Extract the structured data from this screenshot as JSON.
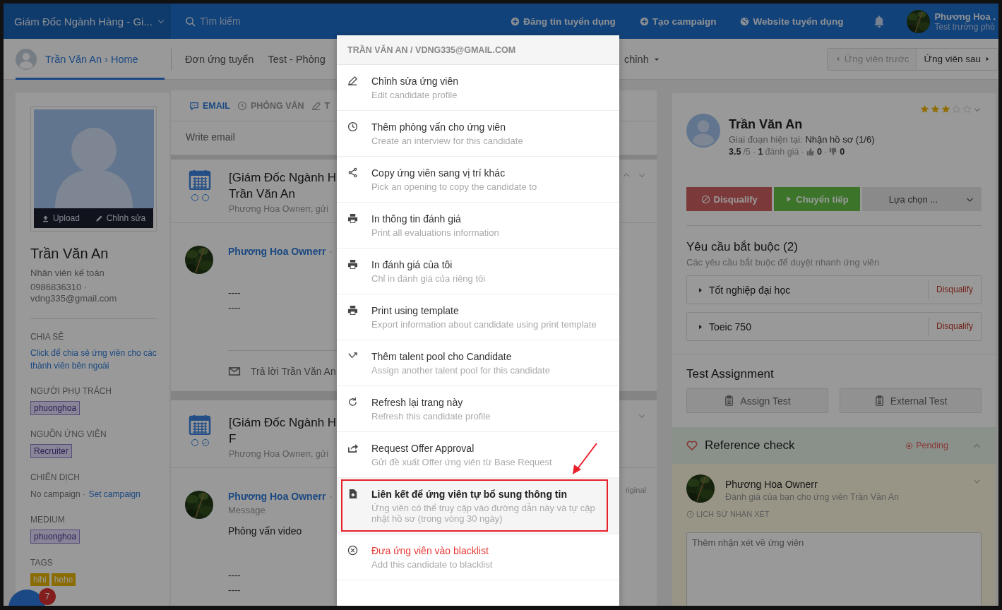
{
  "topbar": {
    "job_selector": "Giám Đốc Ngành Hàng - Gi...",
    "search": {
      "placeholder": "Tìm kiếm"
    },
    "actions": [
      "Đăng tin tuyển dụng",
      "Tạo campaign",
      "Website tuyển dụng"
    ],
    "user": {
      "name": "Phương Hoa .",
      "role": "Test trưởng phò"
    }
  },
  "subnav": {
    "tabs": [
      {
        "label": "Trần Văn An › Home",
        "kind": "home",
        "selected": true
      },
      {
        "label": "Đơn ứng tuyển",
        "kind": "plain",
        "selected": false
      },
      {
        "label": "Test - Phỏng",
        "kind": "plain",
        "selected": false
      },
      {
        "label": "chỉnh",
        "kind": "dropdown",
        "selected": false
      }
    ],
    "prev": {
      "label": "Ứng viên trước",
      "disabled": true
    },
    "next": {
      "label": "Ứng viên sau",
      "disabled": false
    }
  },
  "profile": {
    "photo_actions": [
      "Upload",
      "Chỉnh sửa"
    ],
    "name": "Trần Văn An",
    "title": "Nhân viên kế toán",
    "contact": "0986836310 · vdng335@gmail.com",
    "sections": [
      {
        "heading": "CHIA SẺ",
        "kind": "link",
        "text": "Click để chia sẻ ứng viên cho các thành viên bên ngoài"
      },
      {
        "heading": "NGƯỜI PHỤ TRÁCH",
        "kind": "tags",
        "tags": [
          "phuonghoa"
        ]
      },
      {
        "heading": "NGUỒN ỨNG VIÊN",
        "kind": "tags",
        "tags": [
          "Recruiter"
        ]
      },
      {
        "heading": "CHIẾN DỊCH",
        "kind": "campaign",
        "text": "No campaign ·",
        "link": "Set campaign"
      },
      {
        "heading": "MEDIUM",
        "kind": "tags",
        "tags": [
          "phuonghoa"
        ]
      },
      {
        "heading": "TAGS",
        "kind": "labels",
        "tags": [
          "hihi",
          "hehe"
        ]
      }
    ],
    "chat": {
      "badge": "7"
    }
  },
  "activity": {
    "tabs": [
      {
        "label": "EMAIL",
        "selected": true
      },
      {
        "label": "PHỎNG VẤN",
        "selected": false
      },
      {
        "label": "T",
        "selected": false
      }
    ],
    "compose": {
      "placeholder": "Write email"
    },
    "items": [
      {
        "title_lines": [
          "[Giám Đốc Ngành H",
          "Trần Văn An"
        ],
        "meta": "Phương Hoa Ownerr, gửi",
        "steps": [
          {
            "done": false
          },
          {
            "done": false
          }
        ],
        "expanded": true,
        "comment": {
          "author": "Phương Hoa Ownerr",
          "after": "·",
          "signature": [
            "----",
            "----"
          ],
          "reply": "Trả lời Trần Văn An"
        }
      },
      {
        "title_lines": [
          "[Giám Đốc Ngành H",
          "F"
        ],
        "meta": "Phương Hoa Ownerr, gửi",
        "steps": [
          {
            "done": false
          },
          {
            "done": true
          }
        ],
        "expanded": false,
        "comment": {
          "author": "Phương Hoa Ownerr",
          "after": "·",
          "label": "Message",
          "body": "Phỏng vấn video",
          "signature": [
            "----",
            "----"
          ],
          "side_text": "riginal"
        }
      }
    ]
  },
  "candidate": {
    "stars": 3,
    "name": "Trần Văn An",
    "stage_label": "Giai đoạn hiện tại:",
    "stage": "Nhận hồ sơ (1/6)",
    "rating": {
      "score": "3.5",
      "out_of": "/5 ·",
      "count": "1",
      "count_label": "đánh giá ·",
      "likes": "0",
      "sep": "·",
      "dislikes": "0"
    },
    "actions": [
      {
        "label": "Disqualify",
        "kind": "reject"
      },
      {
        "label": "Chuyển tiếp",
        "kind": "advance"
      },
      {
        "label": "Lựa chọn ...",
        "kind": "select"
      }
    ]
  },
  "requirements": {
    "title": "Yêu cầu bắt buộc (2)",
    "subtitle": "Các yêu cầu bắt buộc để duyệt nhanh ứng viên",
    "items": [
      {
        "label": "Tốt nghiệp đại học",
        "action": "Disqualify"
      },
      {
        "label": "Toeic 750",
        "action": "Disqualify"
      }
    ]
  },
  "tests": {
    "title": "Test Assignment",
    "buttons": [
      "Assign Test",
      "External Test"
    ]
  },
  "reference": {
    "title": "Reference check",
    "status": "Pending",
    "expanded": true,
    "reviewer": {
      "name": "Phương Hoa Ownerr",
      "subtitle": "Đánh giá của bạn cho ứng viên Trần Văn An"
    },
    "history": "LỊCH SỬ NHẬN XÉT",
    "comment": {
      "placeholder": "Thêm nhận xét về ứng viên"
    }
  },
  "menu": {
    "backdrop": true,
    "header": "TRẦN VĂN AN / VDNG335@GMAIL.COM",
    "items": [
      {
        "title": "Chỉnh sửa ứng viên",
        "subtitle": "Edit candidate profile",
        "selected": false,
        "danger": false,
        "annotated": false
      },
      {
        "title": "Thêm phỏng vấn cho ứng viên",
        "subtitle": "Create an interview for this candidate",
        "selected": false,
        "danger": false,
        "annotated": false
      },
      {
        "title": "Copy ứng viên sang vị trí khác",
        "subtitle": "Pick an opening to copy the candidate to",
        "selected": false,
        "danger": false,
        "annotated": false
      },
      {
        "title": "In thông tin đánh giá",
        "subtitle": "Print all evaluations information",
        "selected": false,
        "danger": false,
        "annotated": false
      },
      {
        "title": "In đánh giá của tôi",
        "subtitle": "Chỉ in đánh giá của riêng tôi",
        "selected": false,
        "danger": false,
        "annotated": false
      },
      {
        "title": "Print using template",
        "subtitle": "Export information about candidate using print template",
        "selected": false,
        "danger": false,
        "annotated": false
      },
      {
        "title": "Thêm talent pool cho Candidate",
        "subtitle": "Assign another talent pool for this candidate",
        "selected": false,
        "danger": false,
        "annotated": false
      },
      {
        "title": "Refresh lại trang này",
        "subtitle": "Refresh this candidate profile",
        "selected": false,
        "danger": false,
        "annotated": false
      },
      {
        "title": "Request Offer Approval",
        "subtitle": "Gửi đề xuất Offer ứng viên từ Base Request",
        "selected": false,
        "danger": false,
        "annotated": false
      },
      {
        "title": "Liên kết để ứng viên tự bổ sung thông tin",
        "subtitle": "Ứng viên có thể truy cập vào đường dẫn này và tự cập nhật hồ sơ (trong vòng 30 ngày)",
        "selected": true,
        "danger": false,
        "annotated": true
      },
      {
        "title": "Đưa ứng viên vào blacklist",
        "subtitle": "Add this candidate to blacklist",
        "selected": false,
        "danger": true,
        "annotated": false
      }
    ]
  }
}
